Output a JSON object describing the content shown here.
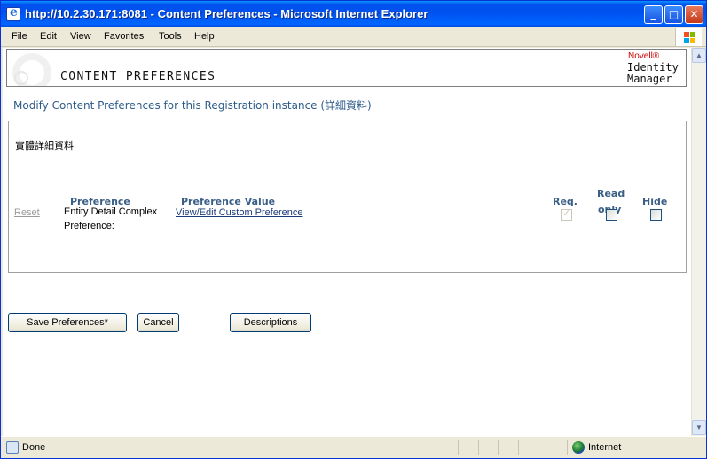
{
  "window": {
    "title": "http://10.2.30.171:8081 - Content Preferences - Microsoft Internet Explorer",
    "min_glyph": "_",
    "max_glyph": "□",
    "close_glyph": "✕"
  },
  "menu": [
    "File",
    "Edit",
    "View",
    "Favorites",
    "Tools",
    "Help"
  ],
  "banner": {
    "title": "CONTENT PREFERENCES",
    "brand_novell": "Novell®",
    "brand_line1": "Identity",
    "brand_line2": "Manager"
  },
  "subtitle": "Modify Content Preferences for this Registration instance (詳細資料)",
  "panel": {
    "section_title": "實體詳細資料",
    "headers": {
      "preference": "Preference",
      "preference_value": "Preference Value",
      "req": "Req.",
      "read_only_1": "Read",
      "read_only_2": "only",
      "hide": "Hide"
    },
    "row": {
      "reset": "Reset",
      "name": "Entity Detail Complex Preference:",
      "value_link": "View/Edit Custom Preference",
      "req_checked": true,
      "read_only_checked": false,
      "hide_checked": false
    }
  },
  "buttons": {
    "save": "Save Preferences*",
    "cancel": "Cancel",
    "descriptions": "Descriptions"
  },
  "status": {
    "text": "Done",
    "zone": "Internet"
  },
  "colors": {
    "title_bar": "#0054e3",
    "header_text": "#3a5f87",
    "link": "#1a3a7a",
    "subtitle": "#2e5c8a",
    "brand": "#cc0000"
  }
}
